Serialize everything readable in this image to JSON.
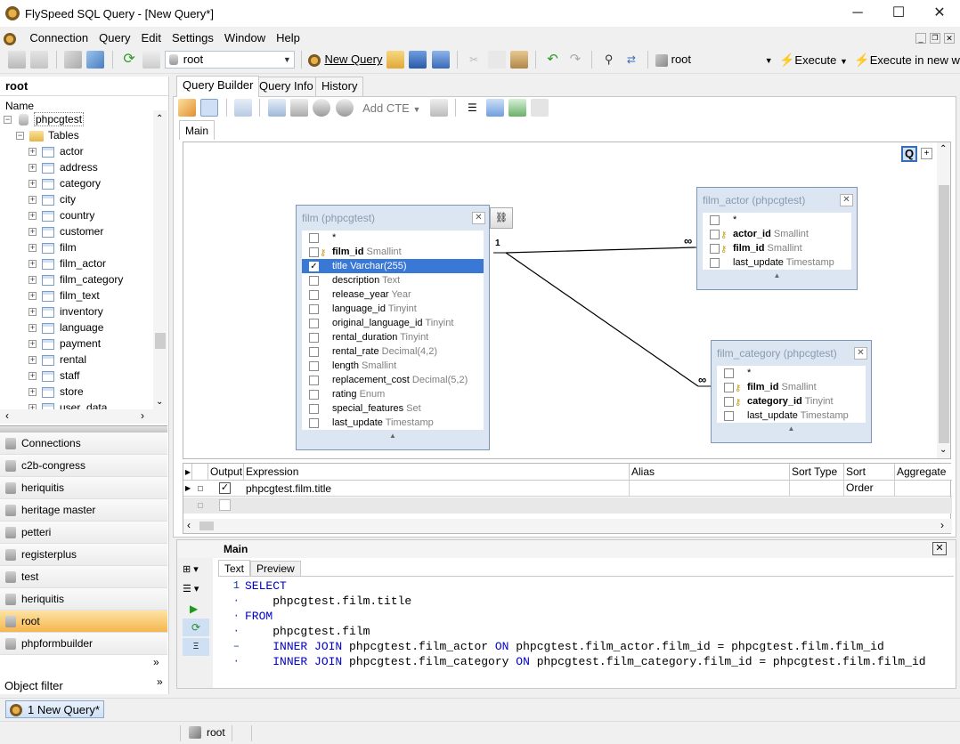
{
  "window": {
    "title": "FlySpeed SQL Query  - [New Query*]"
  },
  "menu": [
    "Connection",
    "Query",
    "Edit",
    "Settings",
    "Window",
    "Help"
  ],
  "toolbar": {
    "connection_combo": "root",
    "new_query": "New Query",
    "conn_label": "root",
    "execute": "Execute",
    "execute_new": "Execute in new window"
  },
  "left": {
    "header": "root",
    "name_col": "Name",
    "database": "phpcgtest",
    "tables_node": "Tables",
    "tables": [
      "actor",
      "address",
      "category",
      "city",
      "country",
      "customer",
      "film",
      "film_actor",
      "film_category",
      "film_text",
      "inventory",
      "language",
      "payment",
      "rental",
      "staff",
      "store",
      "user_data"
    ],
    "connections": [
      "Connections",
      "c2b-congress",
      "heriquitis",
      "heritage master",
      "petteri",
      "registerplus",
      "test",
      "heriquitis",
      "root",
      "phpformbuilder"
    ],
    "active_connection": "root",
    "object_filter": "Object filter"
  },
  "tabs": [
    "Query Builder",
    "Query Info",
    "History"
  ],
  "qb_toolbar": {
    "add_cte": "Add CTE"
  },
  "subtab": "Main",
  "diagram": {
    "badge": "Q",
    "film": {
      "title": "film (phpcgtest)",
      "rows": [
        {
          "name": "*",
          "type": "",
          "pk": false,
          "checked": false
        },
        {
          "name": "film_id",
          "type": "Smallint",
          "pk": true,
          "checked": false
        },
        {
          "name": "title",
          "type": "Varchar(255)",
          "pk": false,
          "checked": true
        },
        {
          "name": "description",
          "type": "Text",
          "pk": false,
          "checked": false
        },
        {
          "name": "release_year",
          "type": "Year",
          "pk": false,
          "checked": false
        },
        {
          "name": "language_id",
          "type": "Tinyint",
          "pk": false,
          "checked": false
        },
        {
          "name": "original_language_id",
          "type": "Tinyint",
          "pk": false,
          "checked": false
        },
        {
          "name": "rental_duration",
          "type": "Tinyint",
          "pk": false,
          "checked": false
        },
        {
          "name": "rental_rate",
          "type": "Decimal(4,2)",
          "pk": false,
          "checked": false
        },
        {
          "name": "length",
          "type": "Smallint",
          "pk": false,
          "checked": false
        },
        {
          "name": "replacement_cost",
          "type": "Decimal(5,2)",
          "pk": false,
          "checked": false
        },
        {
          "name": "rating",
          "type": "Enum",
          "pk": false,
          "checked": false
        },
        {
          "name": "special_features",
          "type": "Set",
          "pk": false,
          "checked": false
        },
        {
          "name": "last_update",
          "type": "Timestamp",
          "pk": false,
          "checked": false
        }
      ]
    },
    "film_actor": {
      "title": "film_actor (phpcgtest)",
      "rows": [
        {
          "name": "*",
          "type": "",
          "pk": false,
          "checked": false
        },
        {
          "name": "actor_id",
          "type": "Smallint",
          "pk": true,
          "checked": false
        },
        {
          "name": "film_id",
          "type": "Smallint",
          "pk": true,
          "checked": false
        },
        {
          "name": "last_update",
          "type": "Timestamp",
          "pk": false,
          "checked": false
        }
      ]
    },
    "film_category": {
      "title": "film_category (phpcgtest)",
      "rows": [
        {
          "name": "*",
          "type": "",
          "pk": false,
          "checked": false
        },
        {
          "name": "film_id",
          "type": "Smallint",
          "pk": true,
          "checked": false
        },
        {
          "name": "category_id",
          "type": "Tinyint",
          "pk": true,
          "checked": false
        },
        {
          "name": "last_update",
          "type": "Timestamp",
          "pk": false,
          "checked": false
        }
      ]
    },
    "link_one": "1",
    "link_many": "∞"
  },
  "grid": {
    "columns": [
      "Output",
      "Expression",
      "Alias",
      "Sort Type",
      "Sort Order",
      "Aggregate"
    ],
    "rows": [
      {
        "output": true,
        "expression": "phpcgtest.film.title",
        "alias": ""
      }
    ]
  },
  "sql_panel": {
    "title": "Main",
    "tabs": [
      "Text",
      "Preview"
    ]
  },
  "sql": [
    {
      "ln": "1",
      "parts": [
        {
          "t": "SELECT",
          "k": true
        }
      ]
    },
    {
      "ln": "·",
      "parts": [
        {
          "t": "    phpcgtest.film.title",
          "k": false
        }
      ]
    },
    {
      "ln": "·",
      "parts": [
        {
          "t": "FROM",
          "k": true
        }
      ]
    },
    {
      "ln": "·",
      "parts": [
        {
          "t": "    phpcgtest.film",
          "k": false
        }
      ]
    },
    {
      "ln": "–",
      "parts": [
        {
          "t": "    ",
          "k": false
        },
        {
          "t": "INNER JOIN",
          "k": true
        },
        {
          "t": " phpcgtest.film_actor ",
          "k": false
        },
        {
          "t": "ON",
          "k": true
        },
        {
          "t": " phpcgtest.film_actor.film_id = phpcgtest.film.film_id",
          "k": false
        }
      ]
    },
    {
      "ln": "·",
      "parts": [
        {
          "t": "    ",
          "k": false
        },
        {
          "t": "INNER JOIN",
          "k": true
        },
        {
          "t": " phpcgtest.film_category ",
          "k": false
        },
        {
          "t": "ON",
          "k": true
        },
        {
          "t": " phpcgtest.film_category.film_id = phpcgtest.film.film_id",
          "k": false
        }
      ]
    }
  ],
  "taskbar": {
    "doc_tab": "1 New Query*"
  },
  "status": {
    "connection": "root"
  }
}
